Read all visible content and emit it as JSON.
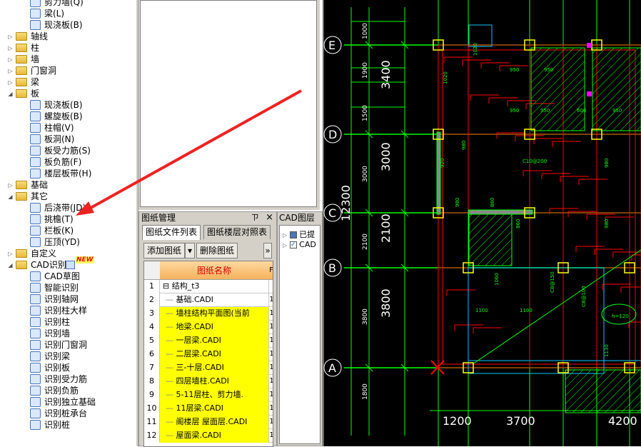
{
  "tree": {
    "items": [
      {
        "label": "剪力墙(Q)",
        "level": 2
      },
      {
        "label": "梁(L)",
        "level": 2
      },
      {
        "label": "现浇板(B)",
        "level": 2
      },
      {
        "label": "轴线",
        "level": 1,
        "toggle": "▷"
      },
      {
        "label": "柱",
        "level": 1,
        "toggle": "▷"
      },
      {
        "label": "墙",
        "level": 1,
        "toggle": "▷"
      },
      {
        "label": "门窗洞",
        "level": 1,
        "toggle": "▷"
      },
      {
        "label": "梁",
        "level": 1,
        "toggle": "▷"
      },
      {
        "label": "板",
        "level": 1,
        "toggle": "◢"
      },
      {
        "label": "现浇板(B)",
        "level": 2
      },
      {
        "label": "螺旋板(B)",
        "level": 2
      },
      {
        "label": "柱帽(V)",
        "level": 2
      },
      {
        "label": "板洞(N)",
        "level": 2
      },
      {
        "label": "板受力筋(S)",
        "level": 2
      },
      {
        "label": "板负筋(F)",
        "level": 2
      },
      {
        "label": "楼层板带(H)",
        "level": 2
      },
      {
        "label": "基础",
        "level": 1,
        "toggle": "▷"
      },
      {
        "label": "其它",
        "level": 1,
        "toggle": "◢"
      },
      {
        "label": "后浇带(JD)",
        "level": 2
      },
      {
        "label": "挑檐(T)",
        "level": 2
      },
      {
        "label": "栏板(K)",
        "level": 2
      },
      {
        "label": "压顶(YD)",
        "level": 2
      },
      {
        "label": "自定义",
        "level": 1,
        "toggle": "▷"
      },
      {
        "label": "CAD识别",
        "level": 1,
        "toggle": "◢",
        "badge": "NEW"
      },
      {
        "label": "CAD草图",
        "level": 2
      },
      {
        "label": "智能识别",
        "level": 2
      },
      {
        "label": "识别轴网",
        "level": 2
      },
      {
        "label": "识别柱大样",
        "level": 2
      },
      {
        "label": "识别柱",
        "level": 2
      },
      {
        "label": "识别墙",
        "level": 2
      },
      {
        "label": "识别门窗洞",
        "level": 2
      },
      {
        "label": "识别梁",
        "level": 2
      },
      {
        "label": "识别板",
        "level": 2
      },
      {
        "label": "识别受力筋",
        "level": 2
      },
      {
        "label": "识别负筋",
        "level": 2
      },
      {
        "label": "识别独立基础",
        "level": 2
      },
      {
        "label": "识别桩承台",
        "level": 2
      },
      {
        "label": "识别桩",
        "level": 2
      }
    ]
  },
  "drawing_manager": {
    "title": "图纸管理",
    "pin": "ㄗ",
    "close": "×",
    "tabs": [
      "图纸文件列表",
      "图纸楼层对照表"
    ],
    "add_button": "添加图纸",
    "dropdown": "▾",
    "delete_button": "删除图纸",
    "more": "»",
    "column_header": "图纸名称",
    "col2_header": "F",
    "rows": [
      {
        "num": "1",
        "name": "结构_t3",
        "group": true,
        "highlight": false,
        "c2": ""
      },
      {
        "num": "2",
        "name": "基础.CADI",
        "highlight": false,
        "c2": "1"
      },
      {
        "num": "3",
        "name": "墙柱结构平面图(当前",
        "highlight": true,
        "c2": "1"
      },
      {
        "num": "4",
        "name": "地梁.CADI",
        "highlight": true,
        "c2": "1"
      },
      {
        "num": "5",
        "name": "一层梁.CADI",
        "highlight": true,
        "c2": "1"
      },
      {
        "num": "6",
        "name": "二层梁.CADI",
        "highlight": true,
        "c2": "1"
      },
      {
        "num": "7",
        "name": "三-十层.CADI",
        "highlight": true,
        "c2": "1"
      },
      {
        "num": "8",
        "name": "四层墙柱.CADI",
        "highlight": true,
        "c2": "1"
      },
      {
        "num": "9",
        "name": "5-11层柱、剪力墙.",
        "highlight": true,
        "c2": "1"
      },
      {
        "num": "10",
        "name": "11层梁.CADI",
        "highlight": true,
        "c2": "1"
      },
      {
        "num": "11",
        "name": "阁楼层 屋面层.CADI",
        "highlight": true,
        "c2": "1"
      },
      {
        "num": "12",
        "name": "屋面梁.CADI",
        "highlight": true,
        "c2": "1"
      }
    ]
  },
  "cad_layer_panel": {
    "title": "CAD图层",
    "close": "×",
    "items": [
      "已提",
      "CAD"
    ]
  },
  "cad_view": {
    "axis_labels": [
      "E",
      "D",
      "C",
      "B",
      "A"
    ],
    "left_dims": [
      "3400",
      "3000",
      "2100",
      "3800"
    ],
    "total_dim": "12300",
    "small_dims": [
      "1000",
      "1900",
      "1500",
      "3000",
      "2100",
      "3800",
      "1800"
    ],
    "bottom_dims": [
      "1200",
      "3700",
      "4200"
    ],
    "labels": [
      "950",
      "950",
      "950",
      "950",
      "600",
      "950",
      "1020",
      "1020",
      "980",
      "920",
      "980",
      "860",
      "860",
      "980",
      "980",
      "1100",
      "1100",
      "1060",
      "1130",
      "C10@200",
      "C8@150",
      "C8@100",
      "h=120"
    ]
  },
  "colors": {
    "accent_yellow": "#ffff00",
    "cad_bg": "#000000",
    "grid_green": "#00ff00",
    "beam_red": "#ff0000",
    "arrow_red": "#ee2222"
  }
}
